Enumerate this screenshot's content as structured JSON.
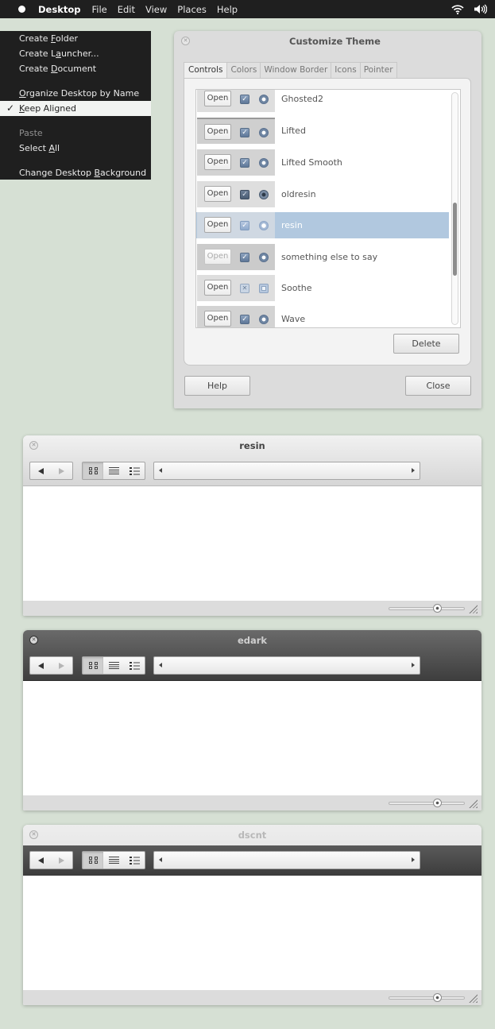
{
  "top_panel": {
    "apple_icon": "apple-logo-icon",
    "app_name": "Desktop",
    "menus": [
      "File",
      "Edit",
      "View",
      "Places",
      "Help"
    ],
    "tray": [
      "wifi-icon",
      "volume-icon"
    ]
  },
  "context_menu": {
    "items": [
      {
        "pre": "Create ",
        "mnemonic": "F",
        "post": "older",
        "state": "normal"
      },
      {
        "pre": "Create L",
        "mnemonic": "a",
        "post": "uncher...",
        "state": "normal"
      },
      {
        "pre": "Create ",
        "mnemonic": "D",
        "post": "ocument",
        "state": "normal"
      },
      {
        "pre": "",
        "mnemonic": "O",
        "post": "rganize Desktop by Name",
        "state": "normal"
      },
      {
        "pre": "",
        "mnemonic": "K",
        "post": "eep Aligned",
        "state": "checked"
      },
      {
        "pre": "Paste",
        "mnemonic": "",
        "post": "",
        "state": "disabled"
      },
      {
        "pre": "Select ",
        "mnemonic": "A",
        "post": "ll",
        "state": "normal"
      },
      {
        "pre": "Change Desktop ",
        "mnemonic": "B",
        "post": "ackground",
        "state": "normal"
      }
    ],
    "check_glyph": "✓"
  },
  "theme_dialog": {
    "title": "Customize Theme",
    "tabs": [
      "Controls",
      "Colors",
      "Window Border",
      "Icons",
      "Pointer"
    ],
    "active_tab": "Controls",
    "open_label": "Open",
    "themes": [
      {
        "name": "Ghosted2",
        "selected": false
      },
      {
        "name": "Lifted",
        "selected": false
      },
      {
        "name": "Lifted Smooth",
        "selected": false
      },
      {
        "name": "oldresin",
        "selected": false
      },
      {
        "name": "resin",
        "selected": true
      },
      {
        "name": "something else to say",
        "selected": false
      },
      {
        "name": "Soothe",
        "selected": false
      },
      {
        "name": "Wave",
        "selected": false
      }
    ],
    "buttons": {
      "delete": "Delete",
      "help": "Help",
      "close": "Close"
    }
  },
  "finder_windows": [
    {
      "title": "resin",
      "zoom_level": 0.65
    },
    {
      "title": "edark",
      "zoom_level": 0.65
    },
    {
      "title": "dscnt",
      "zoom_level": 0.65
    }
  ]
}
